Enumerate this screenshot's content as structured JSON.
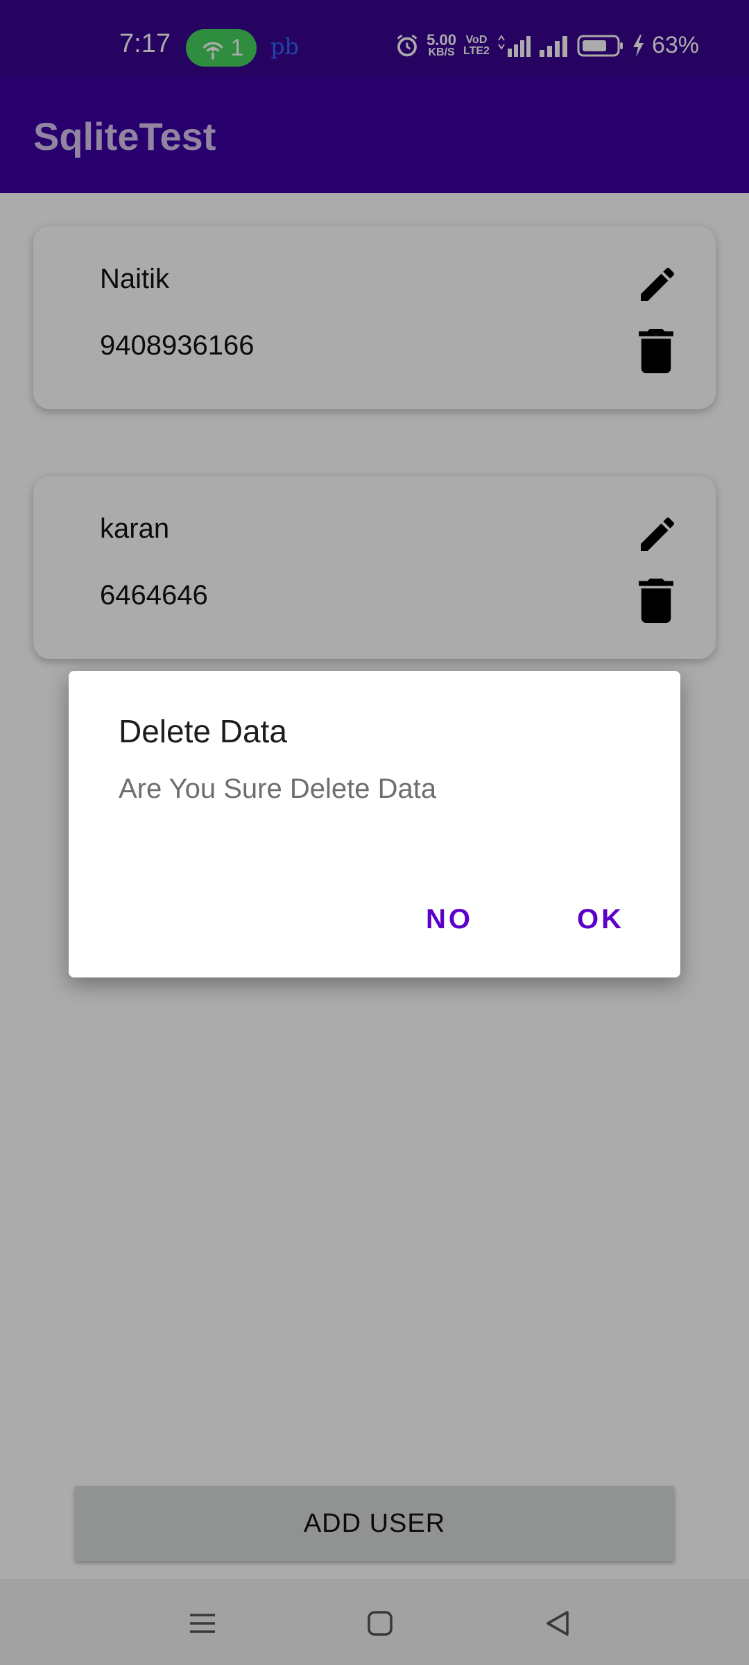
{
  "status_bar": {
    "time": "7:17",
    "hotspot_count": "1",
    "carrier_text": "pb",
    "speed_value": "5.00",
    "speed_unit": "KB/S",
    "volte_top": "VoD",
    "volte_bottom": "LTE2",
    "battery_percent": "63%"
  },
  "app_bar": {
    "title": "SqliteTest"
  },
  "users": [
    {
      "name": "Naitik",
      "phone": "9408936166"
    },
    {
      "name": "karan",
      "phone": "6464646"
    }
  ],
  "add_user_label": "ADD USER",
  "dialog": {
    "title": "Delete Data",
    "message": "Are You Sure Delete Data",
    "negative_label": "NO",
    "positive_label": "OK"
  },
  "colors": {
    "status_bar": "#3a0591",
    "app_bar": "#3d00a3",
    "accent": "#5a00c8"
  },
  "icons": [
    "wifi-hotspot-icon",
    "alarm-icon",
    "signal-icon",
    "battery-icon",
    "charging-icon",
    "edit-icon",
    "delete-icon",
    "menu-icon",
    "home-icon",
    "back-icon"
  ]
}
